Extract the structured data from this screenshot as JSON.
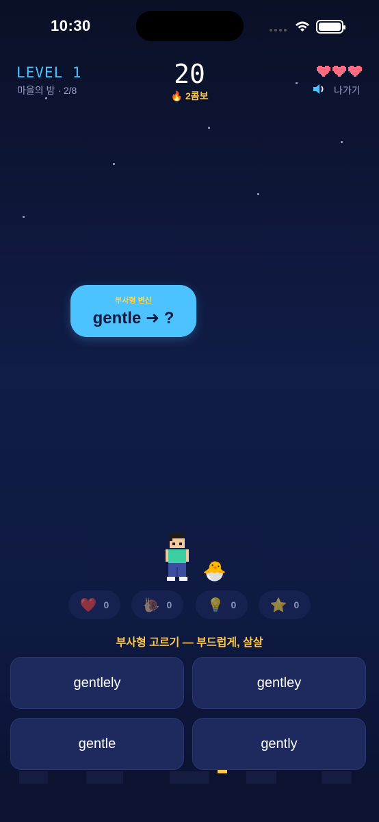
{
  "status_bar": {
    "time": "10:30"
  },
  "hud": {
    "level": "LEVEL 1",
    "stage": "마을의 밤 · 2/8",
    "score": "20",
    "combo_icon": "fire-icon",
    "combo": "2콤보",
    "lives": 3,
    "exit_label": "나가기",
    "colors": {
      "level": "#4fc3ff",
      "combo": "#ffc84a",
      "heart": "#ff6b81"
    }
  },
  "question": {
    "tag": "부사형 변신",
    "prompt": "gentle ➜ ?"
  },
  "powerups": [
    {
      "icon": "heart-icon",
      "glyph": "❤️",
      "count": "0"
    },
    {
      "icon": "snail-icon",
      "glyph": "🐌",
      "count": "0"
    },
    {
      "icon": "lightbulb-icon",
      "glyph": "💡",
      "count": "0"
    },
    {
      "icon": "star-icon",
      "glyph": "⭐",
      "count": "0"
    }
  ],
  "hint": "부사형 고르기 — 부드럽게, 살살",
  "answers": [
    "gentlely",
    "gentley",
    "gentle",
    "gently"
  ]
}
